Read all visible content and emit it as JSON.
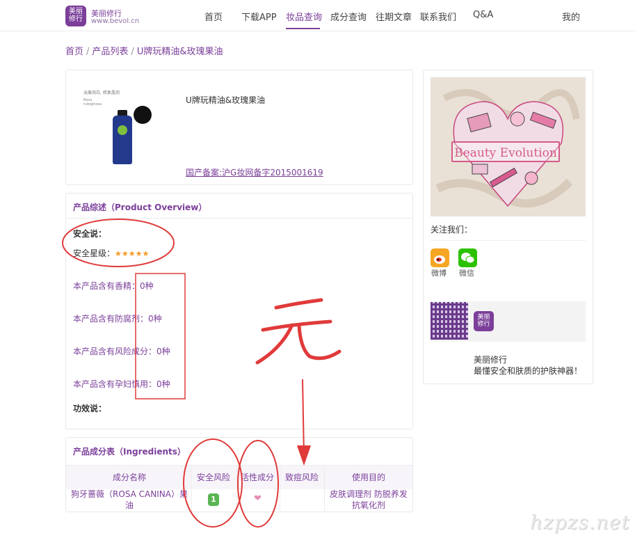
{
  "logo": {
    "brand_mark": "美丽\n修行",
    "title": "美丽修行",
    "url": "www.bevol.cn"
  },
  "nav": [
    {
      "label": "首页",
      "active": false
    },
    {
      "label": "下载APP",
      "active": false
    },
    {
      "label": "妆品查询",
      "active": true
    },
    {
      "label": "成分查询",
      "active": false
    },
    {
      "label": "往期文章",
      "active": false
    },
    {
      "label": "联系我们",
      "active": false
    },
    {
      "label": "Q&A",
      "active": false
    }
  ],
  "nav_user": "我的",
  "breadcrumb": [
    "首页",
    "产品列表",
    "U牌玩精油&玫瑰果油"
  ],
  "product": {
    "name": "U牌玩精油&玫瑰果油",
    "registration": "国产备案:沪G妆网备字2015001619",
    "image_caption": "淡痕润白, 修复晶润",
    "image_sub": "Rosa rubiginosa"
  },
  "overview": {
    "title": "产品综述（Product Overview）",
    "safety_heading": "安全说：",
    "safety_rating_label": "安全星级：",
    "safety_stars": 5,
    "stats": [
      {
        "label": "本产品含有香精：",
        "value": "0种"
      },
      {
        "label": "本产品含有防腐剂：",
        "value": "0种"
      },
      {
        "label": "本产品含有风险成分：",
        "value": "0种"
      },
      {
        "label": "本产品含有孕妇慎用：",
        "value": "0种"
      }
    ],
    "efficacy_heading": "功效说："
  },
  "ingredients": {
    "title": "产品成分表（Ingredients）",
    "columns": [
      "成分名称",
      "安全风险",
      "活性成分",
      "致痘风险",
      "使用目的"
    ],
    "rows": [
      {
        "name": "狗牙蔷薇（ROSA CANINA）果油",
        "safety_risk": "1",
        "active": "heart",
        "acne_risk": "",
        "purpose": "皮肤调理剂 防脱养发 抗氧化剂"
      }
    ]
  },
  "sidebar": {
    "poster_text": "Beauty Evolution",
    "follow_label": "关注我们：",
    "socials": [
      {
        "name": "微博",
        "icon": "weibo-icon",
        "color": "#f5a623"
      },
      {
        "name": "微信",
        "icon": "wechat-icon",
        "color": "#2dc100"
      }
    ],
    "qr_brand": "美丽\n修行",
    "tagline_title": "美丽修行",
    "tagline": "最懂安全和肤质的护肤神器！"
  },
  "annotation": {
    "handwritten": "无"
  },
  "watermark": "hzpzs.net",
  "colors": {
    "accent": "#7b3f9a",
    "star": "#f59a23",
    "safe_green": "#5ab552",
    "annotation_red": "#e03a3a"
  }
}
